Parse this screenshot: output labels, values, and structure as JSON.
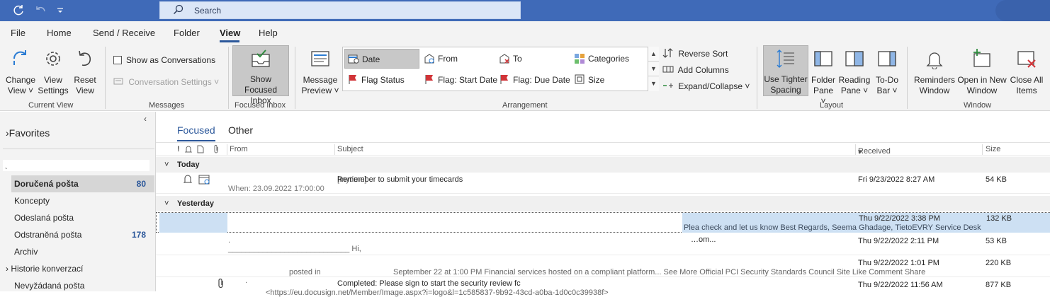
{
  "titlebar": {
    "search_placeholder": "Search",
    "icons": [
      "refresh-icon",
      "undo-icon",
      "customize-qat-icon",
      "search-icon"
    ]
  },
  "menu": {
    "tabs": [
      "File",
      "Home",
      "Send / Receive",
      "Folder",
      "View",
      "Help"
    ],
    "active": "View"
  },
  "ribbon": {
    "current_view": {
      "label": "Current View",
      "change_view": "Change View",
      "view_settings": "View Settings",
      "reset_view": "Reset View"
    },
    "messages": {
      "label": "Messages",
      "show_as_conversations": "Show as Conversations",
      "conversation_settings": "Conversation Settings"
    },
    "focused_inbox": {
      "label": "Focused Inbox",
      "button": "Show Focused Inbox"
    },
    "arrangement": {
      "label": "Arrangement",
      "message_preview": "Message Preview",
      "gallery": [
        "Date",
        "From",
        "To",
        "Categories",
        "Flag Status",
        "Flag: Start Date",
        "Flag: Due Date",
        "Size"
      ],
      "selected": "Date",
      "reverse_sort": "Reverse Sort",
      "add_columns": "Add Columns",
      "expand_collapse": "Expand/Collapse"
    },
    "layout": {
      "label": "Layout",
      "tighter_spacing": "Use Tighter Spacing",
      "folder_pane": "Folder Pane",
      "reading_pane": "Reading Pane",
      "todo_bar": "To-Do Bar"
    },
    "window": {
      "label": "Window",
      "reminders": "Reminders Window",
      "open_new": "Open in New Window",
      "close_all": "Close All Items"
    }
  },
  "folder_pane": {
    "favorites": "Favorites",
    "account_chevron": "ˎ",
    "folders": [
      {
        "name": "Doručená pošta",
        "count": "80",
        "selected": true
      },
      {
        "name": "Koncepty",
        "count": ""
      },
      {
        "name": "Odeslaná pošta",
        "count": ""
      },
      {
        "name": "Odstraněná pošta",
        "count": "178"
      },
      {
        "name": "Archiv",
        "count": ""
      },
      {
        "name": "Historie konverzací",
        "count": ""
      },
      {
        "name": "Nevyžádaná pošta",
        "count": ""
      }
    ]
  },
  "message_list": {
    "tabs": [
      "Focused",
      "Other"
    ],
    "columns": {
      "from": "From",
      "subject": "Subject",
      "received": "Received",
      "size": "Size"
    },
    "groups": [
      "Today",
      "Yesterday"
    ],
    "rows": [
      {
        "subject_prefix": "[mytime]",
        "subject": "Remember to submit your timecards",
        "sub": "When: 23.09.2022 17:00:00",
        "received": "Fri 9/23/2022 8:27 AM",
        "size": "54 KB"
      },
      {
        "subject": "",
        "preview": "Plea check and let us know  Best Regards,  Seema Ghadage,  TietoEVRY Service Desk",
        "received": "Thu 9/22/2022 3:38 PM",
        "size": "132 KB"
      },
      {
        "subject": "",
        "preview": "____________________________  Hi,",
        "tail": "…om...",
        "received": "Thu 9/22/2022 2:11 PM",
        "size": "53 KB"
      },
      {
        "from_line": "posted in",
        "preview": "September 22 at 1:00 PM   Financial services hosted on a compliant platform... See More Official PCI Security Standards Council Site   Like Comment Share",
        "received": "Thu 9/22/2022 1:01 PM",
        "size": "220 KB"
      },
      {
        "subject": "Completed: Please sign to start the security review fc",
        "preview": "<https://eu.docusign.net/Member/Image.aspx?i=logo&l=1c585837-9b92-43cd-a0ba-1d0c0c39938f>",
        "received": "Thu 9/22/2022 11:56 AM",
        "size": "877 KB"
      }
    ]
  }
}
